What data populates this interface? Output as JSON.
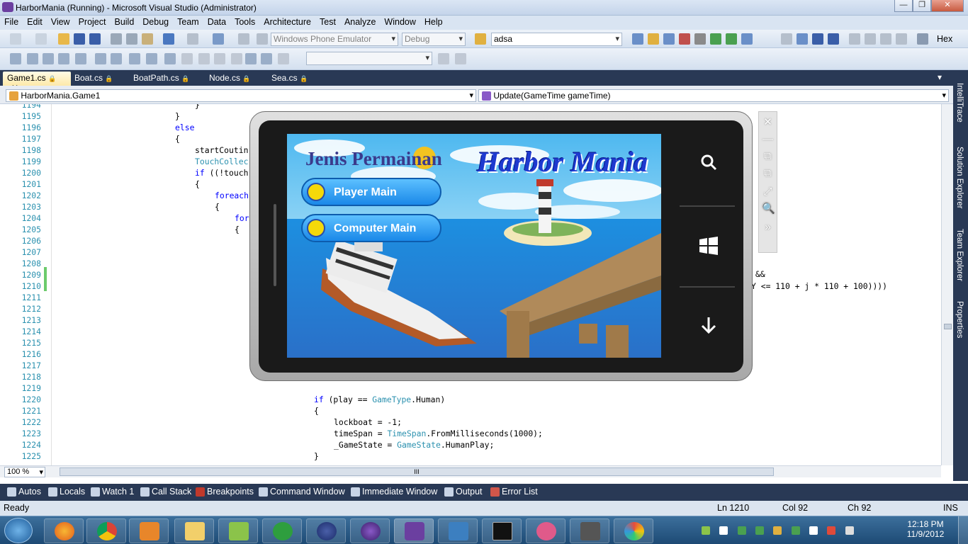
{
  "window": {
    "title": "HarborMania (Running) - Microsoft Visual Studio (Administrator)",
    "min": "—",
    "max": "❐",
    "close": "✕"
  },
  "menu": [
    "File",
    "Edit",
    "View",
    "Project",
    "Build",
    "Debug",
    "Team",
    "Data",
    "Tools",
    "Architecture",
    "Test",
    "Analyze",
    "Window",
    "Help"
  ],
  "toolbar": {
    "target": "Windows Phone Emulator",
    "config": "Debug",
    "find": "adsa",
    "hex": "Hex"
  },
  "tabs": [
    {
      "label": "Game1.cs",
      "lock": "🔒",
      "close": "✕"
    },
    {
      "label": "Boat.cs",
      "lock": "🔒"
    },
    {
      "label": "BoatPath.cs",
      "lock": "🔒"
    },
    {
      "label": "Node.cs",
      "lock": "🔒"
    },
    {
      "label": "Sea.cs",
      "lock": "🔒"
    }
  ],
  "tab_overflow": "▾",
  "nav": {
    "class": "HarborMania.Game1",
    "member": "Update(GameTime gameTime)"
  },
  "editor": {
    "lines": [
      "1194",
      "1195",
      "1196",
      "1197",
      "1198",
      "1199",
      "1200",
      "1201",
      "1202",
      "1203",
      "1204",
      "1205",
      "1206",
      "1207",
      "1208",
      "1209",
      "1210",
      "1211",
      "1212",
      "1213",
      "1214",
      "1215",
      "1216",
      "1217",
      "1218",
      "1219",
      "1220",
      "1221",
      "1222",
      "1223",
      "1224",
      "1225"
    ],
    "code": {
      "l1194": "}",
      "l1195": "}",
      "l1196": "else",
      "l1197": "{",
      "l1198": "startCoutin",
      "l1199": "TouchCollec",
      "l1200_kw": "if",
      "l1200": " ((!touch",
      "l1201": "{",
      "l1202": "foreach",
      "l1203": "{",
      "l1204": "for",
      "l1205": "{",
      "l1209": "&&",
      "l1210": "Y <= 110 + j * 110 + 100))))",
      "l1220_kw": "if",
      "l1220a": " (play == ",
      "l1220_ty": "GameType",
      "l1220b": ".Human)",
      "l1221": "{",
      "l1222": "lockboat = -1;",
      "l1223a": "timeSpan = ",
      "l1223_ty": "TimeSpan",
      "l1223b": ".FromMilliseconds(1000);",
      "l1224a": "_GameState = ",
      "l1224_ty": "GameState",
      "l1224b": ".HumanPlay;",
      "l1225": "}"
    },
    "zoom": "100 %",
    "hscroll_grip": "III"
  },
  "side_tabs": [
    "IntelliTrace",
    "Solution Explorer",
    "Team Explorer",
    "Properties"
  ],
  "emulator": {
    "game_heading": "Jenis Permainan",
    "game_title": "Harbor Mania",
    "button1": "Player Main",
    "button2": "Computer Main",
    "tools": [
      "✕",
      "—",
      "⧉",
      "⧉",
      "⤢",
      "🔍",
      "»"
    ]
  },
  "tool_tabs": [
    "Autos",
    "Locals",
    "Watch 1",
    "Call Stack",
    "Breakpoints",
    "Command Window",
    "Immediate Window",
    "Output",
    "Error List"
  ],
  "status": {
    "left": "Ready",
    "ln": "Ln 1210",
    "col": "Col 92",
    "ch": "Ch 92",
    "mode": "INS"
  },
  "taskbar": {
    "time": "12:18 PM",
    "date": "11/9/2012",
    "apps": [
      "firefox",
      "chrome",
      "media-player",
      "explorer",
      "notepad",
      "green-app",
      "eclipse",
      "eclipse-purple",
      "visual-studio",
      "network",
      "cmd",
      "zune",
      "phone-emulator",
      "paint"
    ]
  },
  "colors": {
    "accent": "#293955",
    "keyword": "#0000ff",
    "type": "#2b91af",
    "sea": "#1f8be0"
  }
}
